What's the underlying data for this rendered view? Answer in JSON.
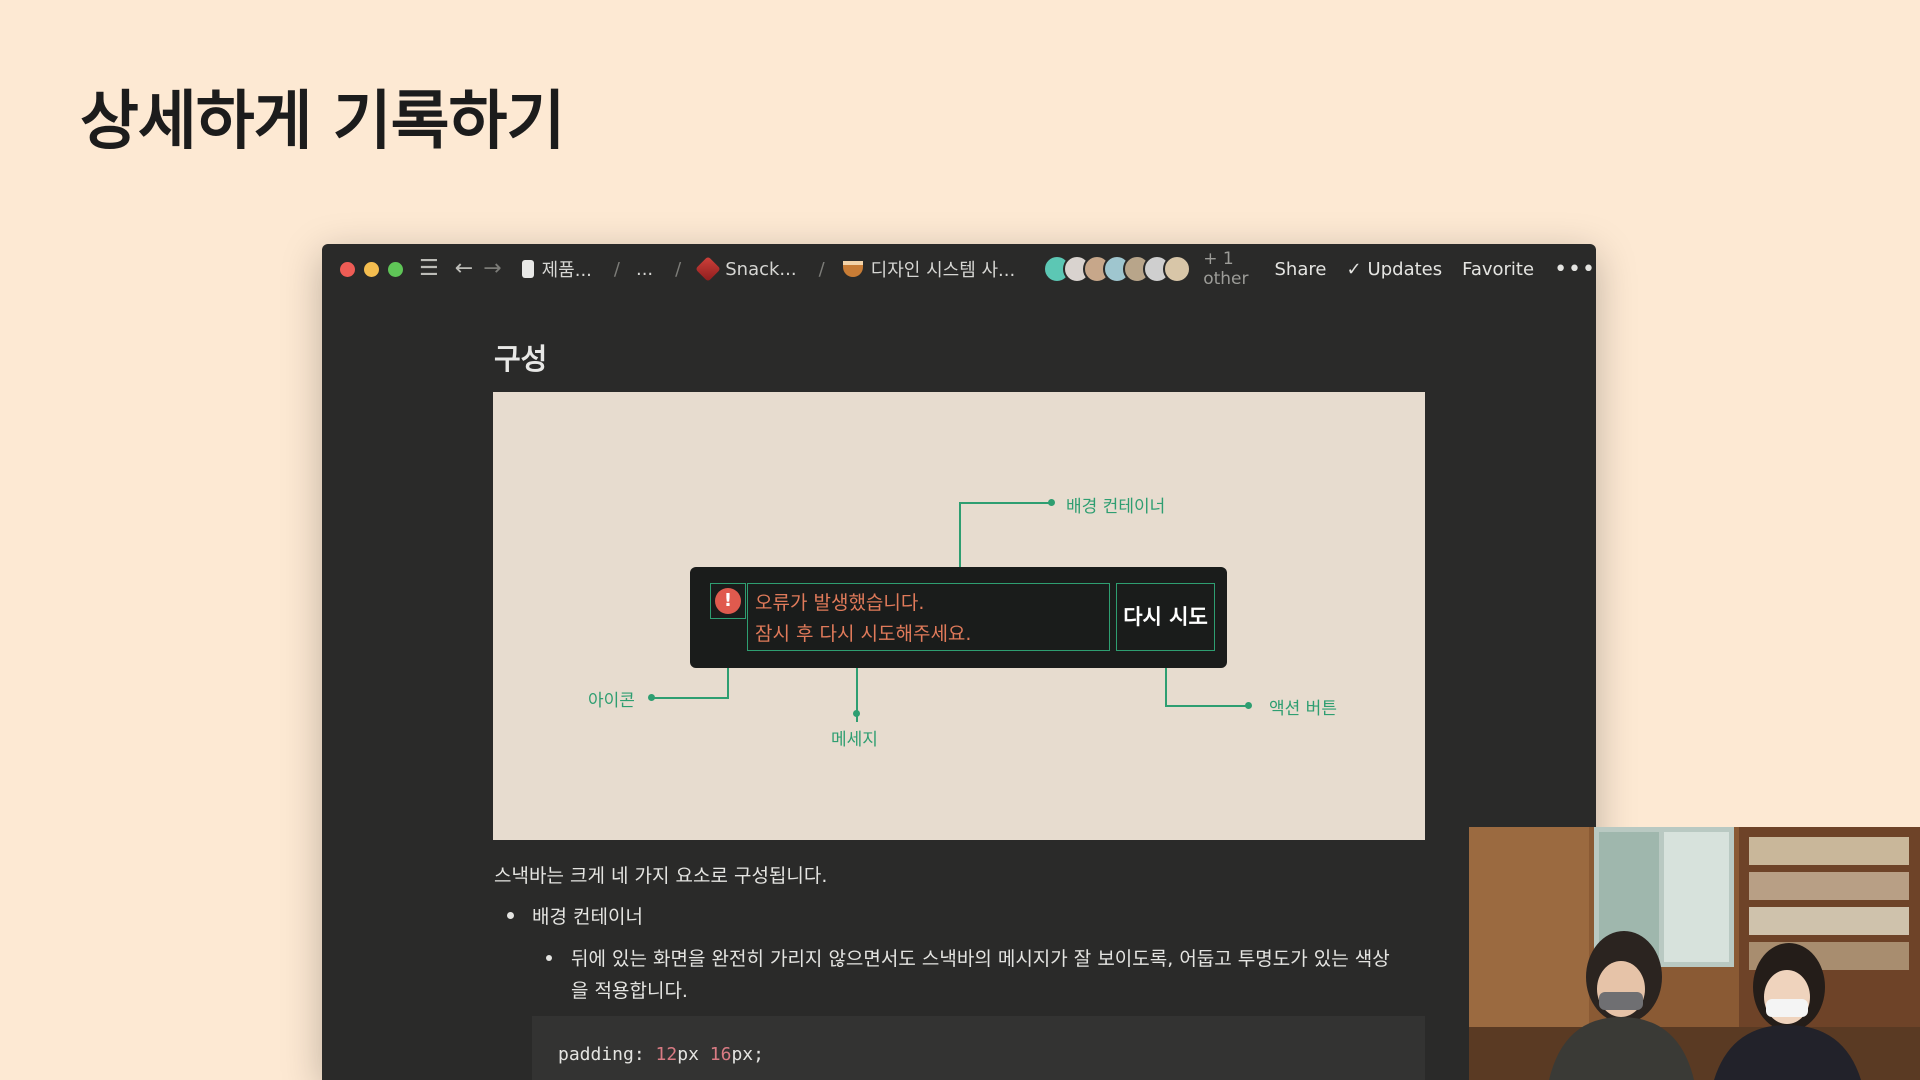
{
  "slide": {
    "title": "상세하게 기록하기"
  },
  "window": {
    "breadcrumb": {
      "items": [
        "제품...",
        "...",
        "Snack...",
        "디자인 시스템 사..."
      ],
      "separator": "/"
    },
    "collaborators": {
      "extra": "+ 1 other"
    },
    "actions": {
      "share": "Share",
      "updates": "Updates",
      "favorite": "Favorite",
      "more": "•••"
    }
  },
  "doc": {
    "section_title": "구성",
    "figure": {
      "annotations": {
        "background": "배경 컨테이너",
        "icon": "아이콘",
        "message": "메세지",
        "action": "액션 버튼"
      },
      "snackbar": {
        "icon": "!",
        "message_line1": "오류가 발생했습니다.",
        "message_line2": "잠시 후 다시 시도해주세요.",
        "button": "다시 시도"
      }
    },
    "intro": "스낵바는 크게 네 가지 요소로 구성됩니다.",
    "bullet1": "배경 컨테이너",
    "sub_bullet_line1": "뒤에 있는 화면을 완전히 가리지 않으면서도 스낵바의 메시지가 잘 보이도록, 어둡고 투명도가 있는 색상",
    "sub_bullet_line2": "을 적용합니다.",
    "code": {
      "prop": "padding:",
      "v1": "12",
      "u1": "px",
      "v2": "16",
      "u2": "px;"
    }
  },
  "colors": {
    "accent_green": "#2e9e71",
    "error_red": "#e05a4e",
    "slide_bg": "#fde9d3",
    "editor_bg": "#2a2a29"
  }
}
